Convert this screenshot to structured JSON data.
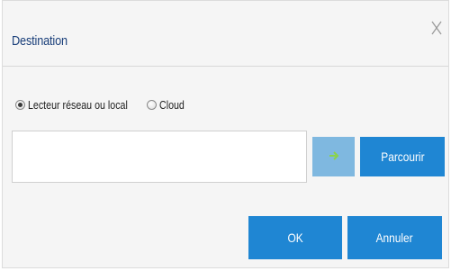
{
  "dialog": {
    "title": "Destination",
    "close_icon": "close-icon"
  },
  "location": {
    "options": [
      {
        "label": "Lecteur réseau ou local",
        "selected": true
      },
      {
        "label": "Cloud",
        "selected": false
      }
    ]
  },
  "path": {
    "value": "",
    "placeholder": ""
  },
  "buttons": {
    "go_icon": "arrow-right-icon",
    "browse_label": "Parcourir",
    "ok_label": "OK",
    "cancel_label": "Annuler"
  },
  "colors": {
    "title": "#1a3f7a",
    "primary_button": "#1f86d3",
    "go_button": "#7fb8e0",
    "go_arrow": "#8bd34a"
  }
}
